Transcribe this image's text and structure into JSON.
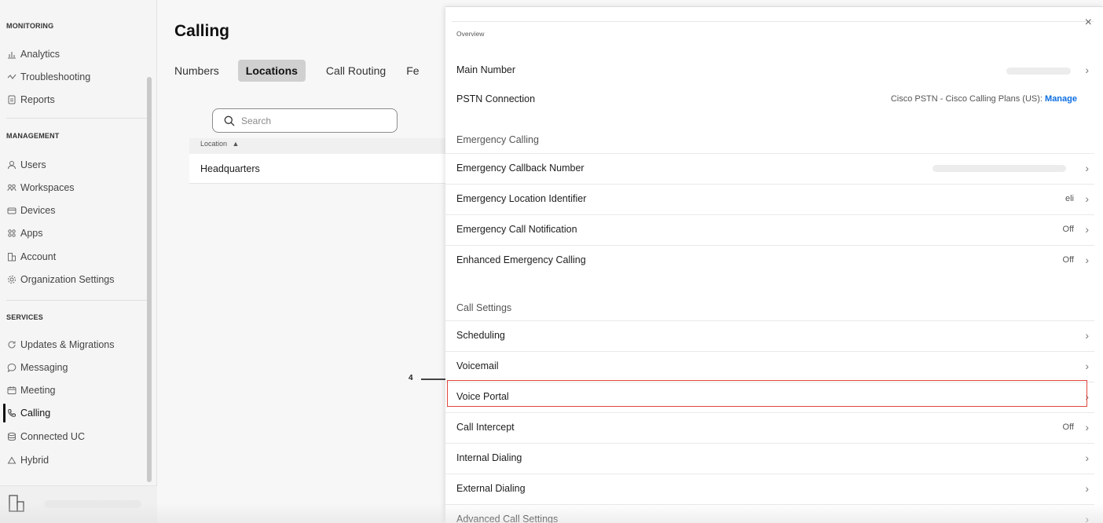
{
  "sidebar": {
    "sections": {
      "monitoring": "MONITORING",
      "management": "MANAGEMENT",
      "services": "SERVICES"
    },
    "items": [
      {
        "label": "Analytics",
        "icon": "analytics-icon"
      },
      {
        "label": "Troubleshooting",
        "icon": "troubleshooting-icon"
      },
      {
        "label": "Reports",
        "icon": "reports-icon"
      },
      {
        "label": "Users",
        "icon": "users-icon"
      },
      {
        "label": "Workspaces",
        "icon": "workspaces-icon"
      },
      {
        "label": "Devices",
        "icon": "devices-icon"
      },
      {
        "label": "Apps",
        "icon": "apps-icon"
      },
      {
        "label": "Account",
        "icon": "account-icon"
      },
      {
        "label": "Organization Settings",
        "icon": "gear-icon"
      },
      {
        "label": "Updates & Migrations",
        "icon": "updates-icon"
      },
      {
        "label": "Messaging",
        "icon": "messaging-icon"
      },
      {
        "label": "Meeting",
        "icon": "meeting-icon"
      },
      {
        "label": "Calling",
        "icon": "phone-icon",
        "active": true
      },
      {
        "label": "Connected UC",
        "icon": "connected-uc-icon"
      },
      {
        "label": "Hybrid",
        "icon": "cloud-icon"
      }
    ]
  },
  "main": {
    "title": "Calling",
    "tabs": [
      {
        "label": "Numbers"
      },
      {
        "label": "Locations",
        "active": true
      },
      {
        "label": "Call Routing"
      },
      {
        "label": "Fe"
      }
    ],
    "search": {
      "placeholder": "Search"
    },
    "table": {
      "header": "Location",
      "rows": [
        "Headquarters"
      ]
    }
  },
  "panel": {
    "overview_label": "Overview",
    "close_glyph": "×",
    "rows_overview": [
      {
        "label": "Main Number",
        "value": ""
      },
      {
        "label": "PSTN Connection",
        "value": "Cisco PSTN - Cisco Calling Plans (US): ",
        "link": "Manage"
      }
    ],
    "emergency_heading": "Emergency Calling",
    "rows_emergency": [
      {
        "label": "Emergency Callback Number",
        "value": ""
      },
      {
        "label": "Emergency Location Identifier",
        "value": "eli"
      },
      {
        "label": "Emergency Call Notification",
        "value": "Off"
      },
      {
        "label": "Enhanced Emergency Calling",
        "value": "Off"
      }
    ],
    "call_settings_heading": "Call Settings",
    "rows_call_settings": [
      {
        "label": "Scheduling",
        "value": ""
      },
      {
        "label": "Voicemail",
        "value": ""
      },
      {
        "label": "Voice Portal",
        "value": "",
        "highlighted": true
      },
      {
        "label": "Call Intercept",
        "value": "Off"
      },
      {
        "label": "Internal Dialing",
        "value": ""
      },
      {
        "label": "External Dialing",
        "value": ""
      },
      {
        "label": "Advanced Call Settings",
        "value": ""
      }
    ],
    "chevron": "›"
  },
  "callout": {
    "number": "4",
    "color": "#e0463c"
  }
}
